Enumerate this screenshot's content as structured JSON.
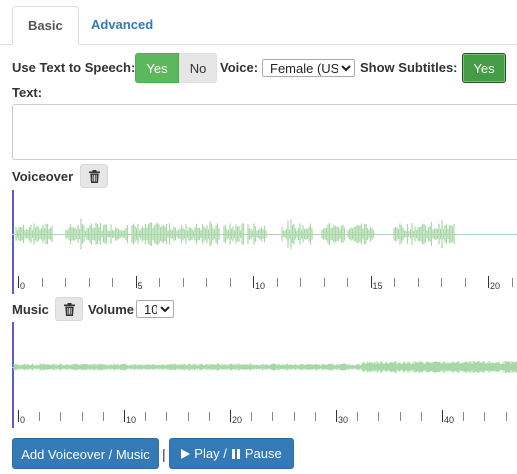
{
  "tabs": [
    {
      "label": "Basic",
      "active": true
    },
    {
      "label": "Advanced",
      "active": false
    }
  ],
  "tts": {
    "label": "Use Text to Speech:",
    "yes": "Yes",
    "no": "No",
    "voice_label": "Voice:",
    "voice_value": "Female (US)",
    "subtitles_label": "Show Subtitles:",
    "subtitles_value": "Yes"
  },
  "text": {
    "label": "Text:",
    "value": ""
  },
  "voiceover": {
    "label": "Voiceover",
    "delete_icon": "trash-icon",
    "wave_color": "#a8d8a8",
    "cursor_color": "#5b5bd6",
    "tick_labels": [
      "0",
      "5",
      "10",
      "15",
      "20"
    ]
  },
  "music": {
    "label": "Music",
    "delete_icon": "trash-icon",
    "volume_label": "Volume",
    "volume_value": "10",
    "tick_labels": [
      "0",
      "10",
      "20",
      "30",
      "40"
    ]
  },
  "buttons": {
    "add_label": "Add Voiceover / Music",
    "separator": "|",
    "play_label": "Play / Pause",
    "play_icon": "play-icon",
    "pause_icon": "pause-icon"
  },
  "colors": {
    "accent": "#337ab7",
    "success": "#5cb85c",
    "wave": "#a8d8a8",
    "cursor": "#5b5bd6"
  }
}
